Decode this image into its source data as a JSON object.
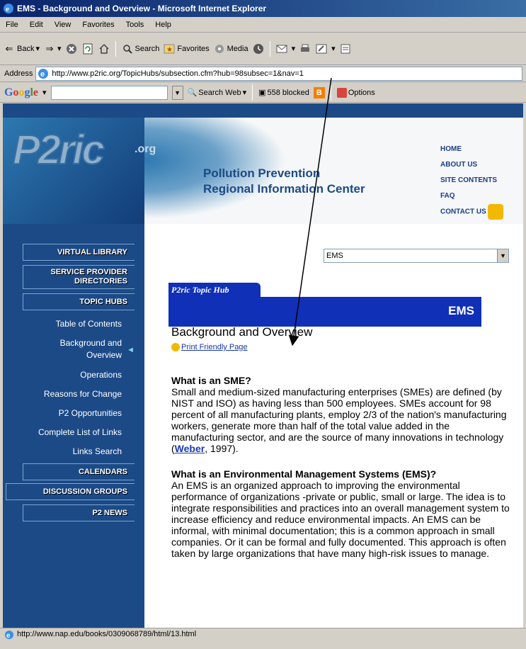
{
  "window": {
    "title": "EMS - Background and Overview - Microsoft Internet Explorer"
  },
  "menu": [
    "File",
    "Edit",
    "View",
    "Favorites",
    "Tools",
    "Help"
  ],
  "toolbar": {
    "back": "Back",
    "search": "Search",
    "favorites": "Favorites",
    "media": "Media"
  },
  "address": {
    "label": "Address",
    "url": "http://www.p2ric.org/TopicHubs/subsection.cfm?hub=98subsec=1&nav=1"
  },
  "google": {
    "logo": "Google",
    "search_web": "Search Web",
    "blocked": "558 blocked",
    "options": "Options"
  },
  "site": {
    "logo": "P2ric",
    "logo_org": ".org",
    "name_line1": "Pollution Prevention",
    "name_line2": "Regional Information Center",
    "nav": [
      "HOME",
      "ABOUT US",
      "SITE CONTENTS",
      "FAQ",
      "CONTACT US"
    ]
  },
  "sidebar": {
    "virtual_library": "VIRTUAL LIBRARY",
    "service_provider_1": "SERVICE PROVIDER",
    "service_provider_2": "DIRECTORIES",
    "topic_hubs": "TOPIC HUBS",
    "links": [
      "Table of Contents",
      "Background and",
      "Overview",
      "Operations",
      "Reasons for Change",
      "P2 Opportunities",
      "Complete List of Links",
      "Links Search"
    ],
    "calendars": "CALENDARS",
    "discussion_groups": "DISCUSSION GROUPS",
    "p2_news": "P2 NEWS"
  },
  "main": {
    "select_value": "EMS",
    "hub_tab": "P2ric Topic Hub",
    "hub_title": "EMS",
    "page_title": "Background and Overview",
    "print_link": "Print Friendly Page",
    "section1_title": "What is an SME?",
    "section1_text": "Small and medium-sized manufacturing enterprises (SMEs) are defined (by NIST and ISO) as having less than 500 employees. SMEs account for 98 percent of all manufacturing plants, employ 2/3 of the nation's manufacturing workers, generate more than half of the total value added in the manufacturing sector, and are the source of many innovations in technology (",
    "section1_link": "Weber",
    "section1_tail": ", 1997).",
    "section2_title": "What is an Environmental Management Systems (EMS)?",
    "section2_text": "An EMS is an organized approach to improving the environmental performance of organizations -private or public, small or large. The idea is to integrate responsibilities and practices into an overall management system to increase efficiency and reduce environmental impacts. An EMS can be informal, with minimal documentation; this is a common approach in small companies. Or it can be formal and fully documented. This approach is often taken by large organizations that have many high-risk issues to manage."
  },
  "status": {
    "text": "http://www.nap.edu/books/0309068789/html/13.html"
  }
}
